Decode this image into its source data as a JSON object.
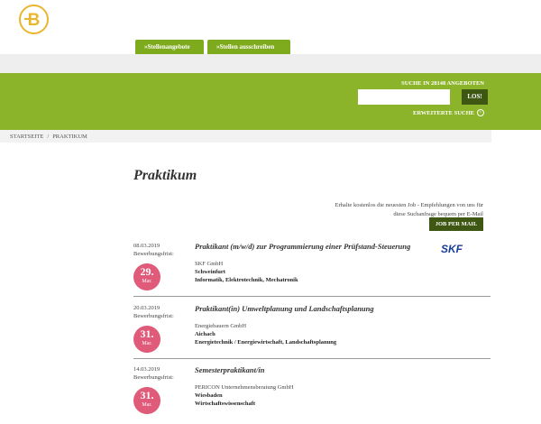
{
  "header": {
    "nav": [
      "»Stellenangebote",
      "»Stellen ausschreiben"
    ]
  },
  "search": {
    "label": "SUCHE IN 28148 ANGEBOTEN",
    "input_value": "",
    "button": "LOS!",
    "advanced": "ERWEITERTE SUCHE",
    "advanced_icon": "circle-arrow-icon"
  },
  "breadcrumb": [
    "STARTSEITE",
    "PRAKTIKUM"
  ],
  "page_title": "Praktikum",
  "jobmail": {
    "text": "Erhalte kostenlos die neuesten Job - Empfehlungen von uns für diese Suchanfrage bequem per E-Mail",
    "button": "JOB PER MAIL"
  },
  "jobs": [
    {
      "date": "08.03.2019",
      "deadline_label": "Bewerbungsfrist:",
      "deadline_day": "29.",
      "deadline_month": "Mar.",
      "title": "Praktikant (m/w/d) zur Programmierung einer Prüfstand-Steuerung",
      "company": "SKF GmbH",
      "city": "Schweinfurt",
      "field": "Informatik, Elektrotechnik, Mechatronik",
      "logo_text": "SKF"
    },
    {
      "date": "20.03.2019",
      "deadline_label": "Bewerbungsfrist:",
      "deadline_day": "31.",
      "deadline_month": "Mar.",
      "title": "Praktikant(in) Umweltplanung und Landschaftsplanung",
      "company": "Energiebauern GmbH",
      "city": "Aichach",
      "field": "Energietechnik / Energiewirtschaft, Landschaftsplanung"
    },
    {
      "date": "14.03.2019",
      "deadline_label": "Bewerbungsfrist:",
      "deadline_day": "31.",
      "deadline_month": "Mar.",
      "title": "Semesterpraktikant/in",
      "company": "PERICON Unternehmensberatung GmbH",
      "city": "Wiesbaden",
      "field": "Wirtschaftswissenschaft"
    }
  ],
  "colors": {
    "brand_green": "#8cb42a",
    "dark_green": "#3e5712",
    "badge_pink": "#e05a7a",
    "logo_gold": "#e9b62e"
  }
}
